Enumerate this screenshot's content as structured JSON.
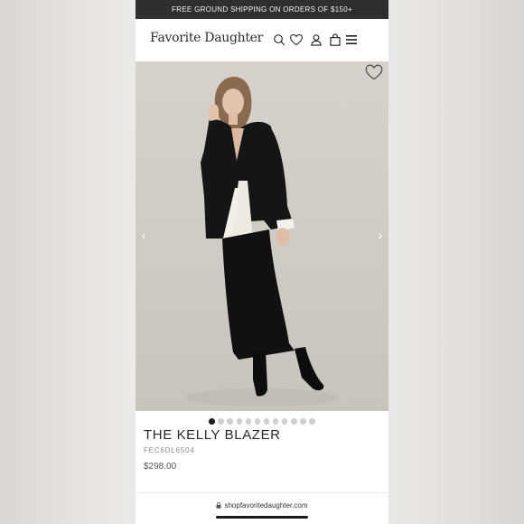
{
  "promo": {
    "text": "FREE GROUND SHIPPING ON ORDERS OF $150+"
  },
  "header": {
    "logo": "Favorite Daughter",
    "icons": [
      "search-icon",
      "heart-icon",
      "account-icon",
      "bag-icon",
      "menu-icon"
    ]
  },
  "product": {
    "title": "THE KELLY BLAZER",
    "sku": "FEC6DL6504",
    "price": "$298.00",
    "carousel": {
      "total_images": 12,
      "active_index": 1
    }
  },
  "browser": {
    "url": "shopfavoritedaughter.com"
  },
  "colors": {
    "promo_bg": "#2f2f2f",
    "text": "#2a2a2a",
    "active_dot": "#1e1e1e",
    "inactive_dot": "#d0d0d0"
  }
}
